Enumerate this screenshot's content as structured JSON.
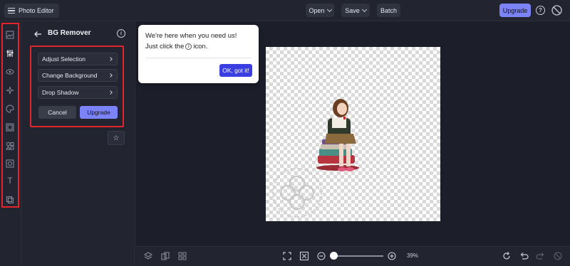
{
  "header": {
    "app_title": "Photo Editor",
    "open_label": "Open",
    "save_label": "Save",
    "batch_label": "Batch",
    "upgrade_label": "Upgrade",
    "help_icon": "?"
  },
  "rail": {
    "icons": [
      "image-icon",
      "sliders-icon",
      "eye-icon",
      "sparkles-icon",
      "palette-icon",
      "frame-icon",
      "shapes-icon",
      "texture-icon",
      "text-icon",
      "layers-icon"
    ],
    "text_glyph": "T"
  },
  "panel": {
    "title": "BG Remover",
    "info_glyph": "i",
    "options": [
      {
        "label": "Adjust Selection"
      },
      {
        "label": "Change Background"
      },
      {
        "label": "Drop Shadow"
      }
    ],
    "cancel_label": "Cancel",
    "upgrade_label": "Upgrade",
    "star_glyph": "☆"
  },
  "popup": {
    "line1": "We're here when you need us!",
    "line2_before": "Just click the",
    "line2_icon": "i",
    "line2_after": "icon.",
    "ok_label": "OK, got it!"
  },
  "bottom": {
    "zoom_label": "39%",
    "zoom_level": 0.39
  },
  "colors": {
    "accent": "#7c83f7",
    "popup_button": "#3b3ee0",
    "highlight_outline": "#e0262a",
    "background": "#1c1f2a"
  }
}
